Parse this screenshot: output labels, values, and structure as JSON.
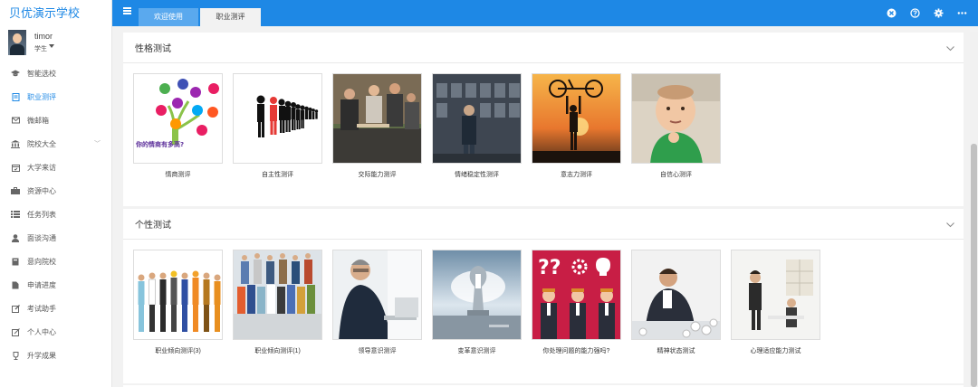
{
  "app": {
    "brand": "贝优演示学校"
  },
  "user": {
    "name": "timor",
    "role": "学生"
  },
  "sidebar": {
    "items": [
      {
        "label": "智能选校",
        "icon": "graduation-cap-icon"
      },
      {
        "label": "职业测评",
        "icon": "clipboard-icon",
        "active": true
      },
      {
        "label": "微邮箱",
        "icon": "mail-icon"
      },
      {
        "label": "院校大全",
        "icon": "building-icon"
      },
      {
        "label": "大学来访",
        "icon": "calendar-icon"
      },
      {
        "label": "资源中心",
        "icon": "briefcase-icon"
      },
      {
        "label": "任务列表",
        "icon": "list-icon"
      },
      {
        "label": "面谈沟通",
        "icon": "person-icon"
      },
      {
        "label": "意向院校",
        "icon": "bookmark-icon"
      },
      {
        "label": "申请进度",
        "icon": "file-icon"
      },
      {
        "label": "考试助手",
        "icon": "edit-icon"
      },
      {
        "label": "个人中心",
        "icon": "profile-edit-icon"
      },
      {
        "label": "升学成果",
        "icon": "trophy-icon"
      }
    ]
  },
  "topbar": {
    "tabs": [
      {
        "label": "欢迎使用"
      },
      {
        "label": "职业测评"
      }
    ]
  },
  "sections": [
    {
      "title": "性格测试",
      "cards": [
        {
          "label": "情商测评"
        },
        {
          "label": "自主性测评"
        },
        {
          "label": "交际能力测评"
        },
        {
          "label": "情绪稳定性测评"
        },
        {
          "label": "意志力测评"
        },
        {
          "label": "自信心测评"
        }
      ]
    },
    {
      "title": "个性测试",
      "cards": [
        {
          "label": "职业倾向测评(3)"
        },
        {
          "label": "职业倾向测评(1)"
        },
        {
          "label": "领导意识测评"
        },
        {
          "label": "变革意识测评"
        },
        {
          "label": "你处理问题的能力强吗?"
        },
        {
          "label": "精神状态测试"
        },
        {
          "label": "心理适应能力测试"
        }
      ]
    }
  ],
  "thumbnail_text": {
    "eq_tree_caption": "你的情商有多高?"
  },
  "colors": {
    "accent": "#1e88e5",
    "tab_active": "#5aa9ee"
  }
}
